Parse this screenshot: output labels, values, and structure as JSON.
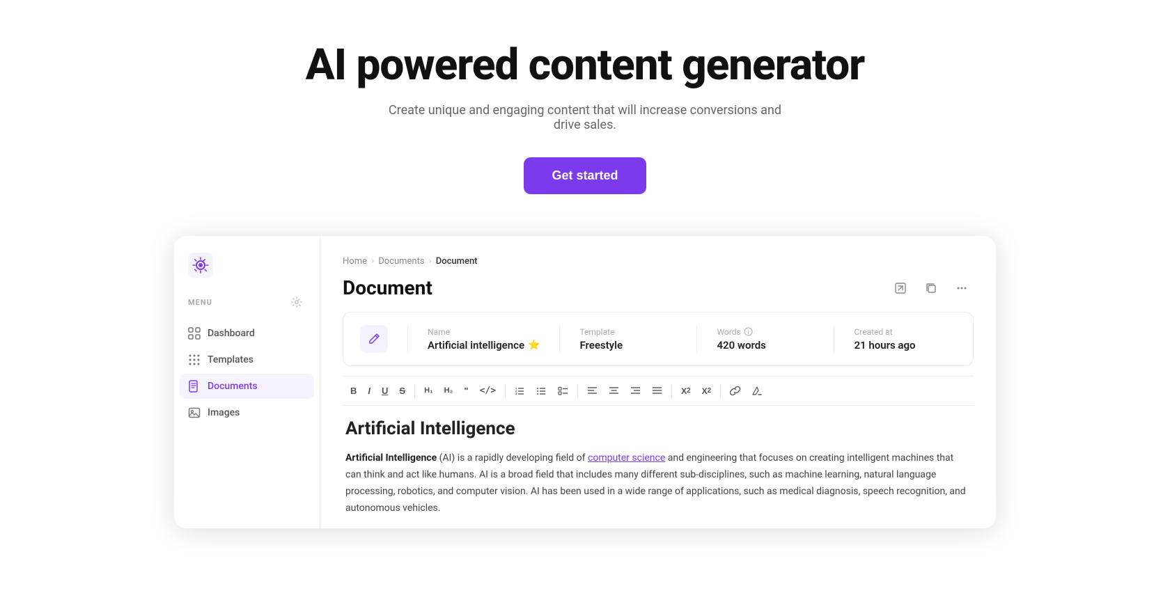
{
  "hero": {
    "title": "AI powered content generator",
    "subtitle": "Create unique and engaging content that will increase conversions and drive sales.",
    "cta_label": "Get started"
  },
  "sidebar": {
    "menu_label": "MENU",
    "nav_items": [
      {
        "id": "dashboard",
        "label": "Dashboard",
        "icon": "grid-icon"
      },
      {
        "id": "templates",
        "label": "Templates",
        "icon": "grid-dots-icon"
      },
      {
        "id": "documents",
        "label": "Documents",
        "icon": "doc-icon",
        "active": true
      },
      {
        "id": "images",
        "label": "Images",
        "icon": "image-icon"
      }
    ]
  },
  "breadcrumb": {
    "items": [
      "Home",
      "Documents",
      "Document"
    ]
  },
  "page": {
    "title": "Document"
  },
  "doc_meta": {
    "name_label": "Name",
    "name_value": "Artificial intelligence",
    "star": "⭐",
    "template_label": "Template",
    "template_value": "Freestyle",
    "words_label": "Words",
    "words_value": "420 words",
    "created_label": "Created at",
    "created_value": "21 hours ago"
  },
  "toolbar": {
    "buttons": [
      "B",
      "I",
      "U",
      "S",
      "H1",
      "H2",
      "\"",
      "</>",
      "OL",
      "UL",
      "□",
      "≡",
      "◁",
      "▷",
      "¶",
      "≡",
      "≡",
      "≡",
      "X₂",
      "X²",
      "🔗",
      "T"
    ]
  },
  "doc_content": {
    "title": "Artificial Intelligence",
    "body_intro_bold": "Artificial Intelligence",
    "body_intro": " (AI) is a rapidly developing field of ",
    "body_link": "computer science",
    "body_rest": " and engineering that focuses on creating intelligent machines that can think and act like humans. AI is a broad field that includes many different sub-disciplines, such as machine learning, natural language processing, robotics, and computer vision. AI has been used in a wide range of applications, such as medical diagnosis, speech recognition, and autonomous vehicles."
  }
}
